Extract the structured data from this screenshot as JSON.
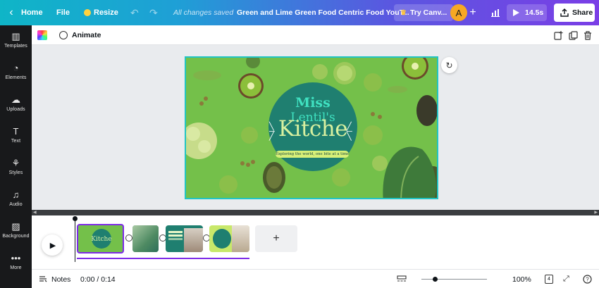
{
  "topbar": {
    "home_label": "Home",
    "file_label": "File",
    "resize_label": "Resize",
    "saved_status": "All changes saved",
    "design_title": "Green and Lime Green Food Centric Food YouT...",
    "try_canva_label": "Try Canv...",
    "avatar_initial": "A",
    "present_label": "14.5s",
    "share_label": "Share"
  },
  "sidebar": {
    "items": [
      {
        "label": "Templates",
        "icon": "templates-icon"
      },
      {
        "label": "Elements",
        "icon": "elements-icon"
      },
      {
        "label": "Uploads",
        "icon": "uploads-icon"
      },
      {
        "label": "Text",
        "icon": "text-icon"
      },
      {
        "label": "Styles",
        "icon": "styles-icon"
      },
      {
        "label": "Audio",
        "icon": "audio-icon"
      },
      {
        "label": "Background",
        "icon": "background-icon"
      },
      {
        "label": "More",
        "icon": "more-icon"
      }
    ]
  },
  "toolbar": {
    "animate_label": "Animate"
  },
  "slide": {
    "title_line1": "Miss",
    "title_line2": "Lentil's",
    "title_line3": "Kitche",
    "tagline": "Exploring the world, one bite at a time"
  },
  "footer": {
    "notes_label": "Notes",
    "timecode": "0:00 / 0:14",
    "zoom": "100%",
    "page_count": "4",
    "zoom_fraction": 0.2
  },
  "colors": {
    "accent": "#7d2ae8",
    "slide_bg": "#74c04a",
    "circle": "#1f7f70",
    "title_teal": "#3fe0c0",
    "title_lime": "#d8f0a0"
  }
}
